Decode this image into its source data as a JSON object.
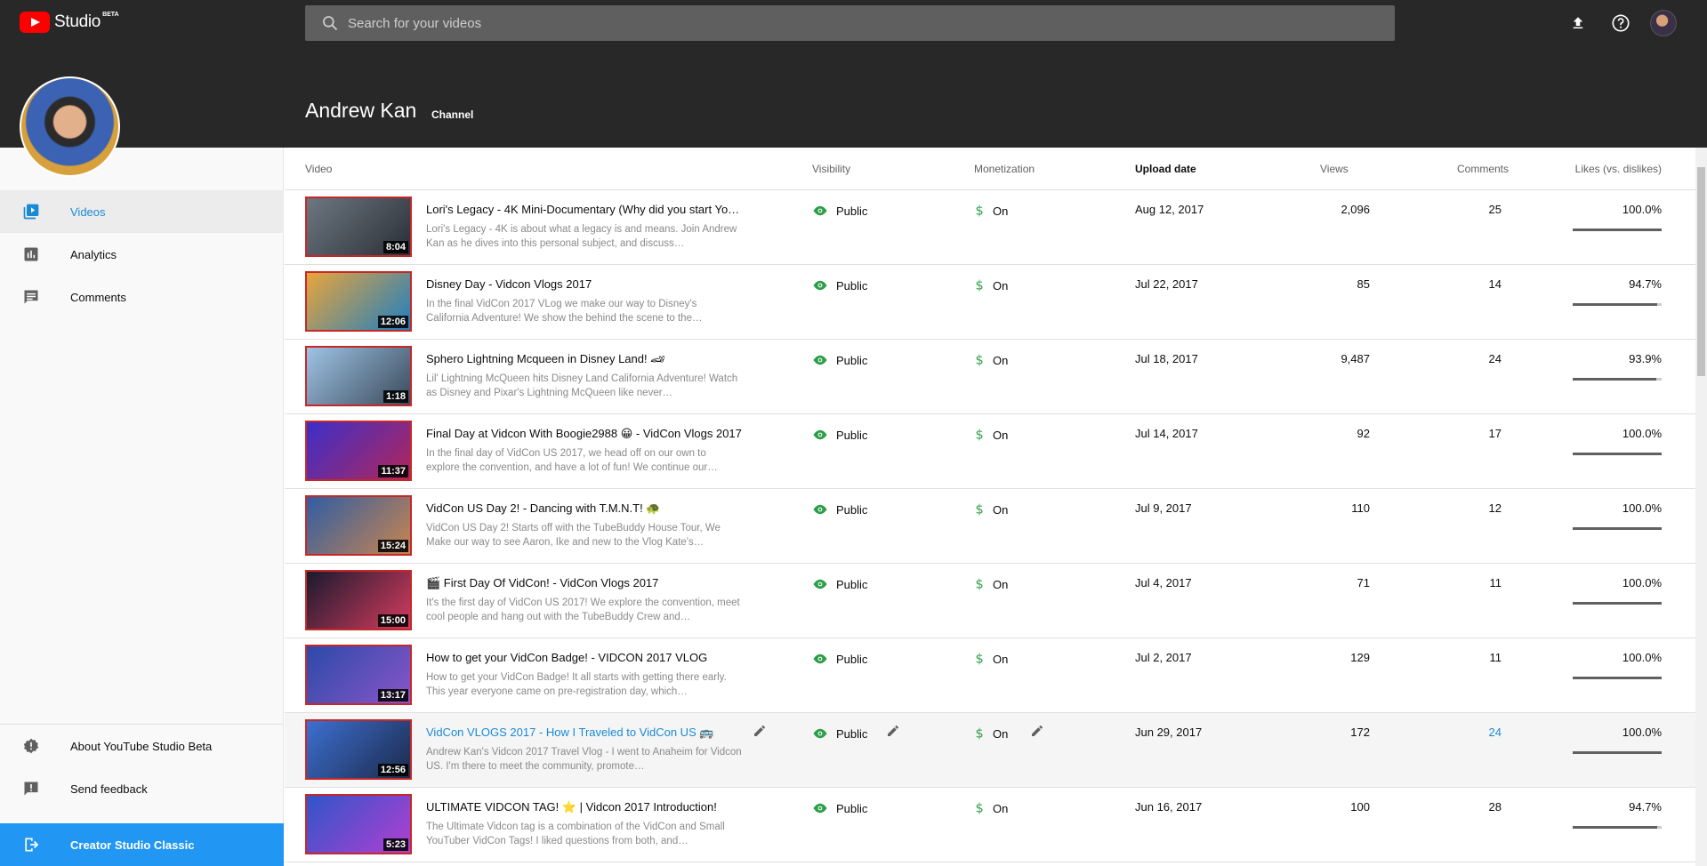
{
  "app": {
    "logo_text": "Studio",
    "beta": "BETA"
  },
  "search": {
    "placeholder": "Search for your videos"
  },
  "channel": {
    "name": "Andrew Kan",
    "label": "Channel"
  },
  "sidebar": {
    "items": [
      {
        "label": "Videos",
        "icon": "video-library-icon",
        "active": true
      },
      {
        "label": "Analytics",
        "icon": "analytics-icon",
        "active": false
      },
      {
        "label": "Comments",
        "icon": "comments-icon",
        "active": false
      }
    ],
    "bottom_items": [
      {
        "label": "About YouTube Studio Beta",
        "icon": "info-icon"
      },
      {
        "label": "Send feedback",
        "icon": "feedback-icon"
      }
    ],
    "classic_label": "Creator Studio Classic"
  },
  "table": {
    "headers": {
      "video": "Video",
      "visibility": "Visibility",
      "monetization": "Monetization",
      "upload_date": "Upload date",
      "views": "Views",
      "comments": "Comments",
      "likes": "Likes (vs. dislikes)"
    },
    "rows": [
      {
        "title": "Lori's Legacy - 4K Mini-Documentary (Why did you start Yo…",
        "description": "Lori's Legacy - 4K is about what a legacy is and means. Join Andrew Kan as he dives into this personal subject, and discuss…",
        "duration": "8:04",
        "visibility": "Public",
        "monetization": "On",
        "date": "Aug 12, 2017",
        "views": "2,096",
        "comments": "25",
        "likes": "100.0%",
        "likes_fraction": 1.0,
        "thumb_colors": [
          "#6d7781",
          "#2a2f36"
        ]
      },
      {
        "title": "Disney Day - Vidcon Vlogs 2017",
        "description": "In the final VidCon 2017 VLog we make our way to Disney's California Adventure! We show the behind the scene to the…",
        "duration": "12:06",
        "visibility": "Public",
        "monetization": "On",
        "date": "Jul 22, 2017",
        "views": "85",
        "comments": "14",
        "likes": "94.7%",
        "likes_fraction": 0.947,
        "thumb_colors": [
          "#e9a53a",
          "#1e7fc1"
        ]
      },
      {
        "title": "Sphero Lightning Mcqueen in Disney Land! 🏎",
        "description": "Lil' Lightning McQueen hits Disney Land California Adventure! Watch as Disney and Pixar's Lightning McQueen like never…",
        "duration": "1:18",
        "visibility": "Public",
        "monetization": "On",
        "date": "Jul 18, 2017",
        "views": "9,487",
        "comments": "24",
        "likes": "93.9%",
        "likes_fraction": 0.939,
        "thumb_colors": [
          "#9ec3e6",
          "#3b4a5a"
        ]
      },
      {
        "title": "Final Day at Vidcon With Boogie2988 😀 - VidCon Vlogs 2017",
        "description": "In the final day of VidCon US 2017, we head off on our own to explore the convention, and have a lot of fun! We continue our…",
        "duration": "11:37",
        "visibility": "Public",
        "monetization": "On",
        "date": "Jul 14, 2017",
        "views": "92",
        "comments": "17",
        "likes": "100.0%",
        "likes_fraction": 1.0,
        "thumb_colors": [
          "#3b2fc8",
          "#b2265b"
        ]
      },
      {
        "title": "VidCon US Day 2! - Dancing with T.M.N.T! 🐢",
        "description": "VidCon US Day 2! Starts off with the TubeBuddy House Tour, We Make our way to see Aaron, Ike and new to the Vlog Kate's…",
        "duration": "15:24",
        "visibility": "Public",
        "monetization": "On",
        "date": "Jul 9, 2017",
        "views": "110",
        "comments": "12",
        "likes": "100.0%",
        "likes_fraction": 1.0,
        "thumb_colors": [
          "#2f5da3",
          "#c9844f"
        ]
      },
      {
        "title": "🎬 First Day Of VidCon! - VidCon Vlogs 2017",
        "description": "It's the first day of VidCon US 2017! We explore the convention, meet cool people and hang out with the TubeBuddy Crew and…",
        "duration": "15:00",
        "visibility": "Public",
        "monetization": "On",
        "date": "Jul 4, 2017",
        "views": "71",
        "comments": "11",
        "likes": "100.0%",
        "likes_fraction": 1.0,
        "thumb_colors": [
          "#1a1a2e",
          "#d43b5e"
        ]
      },
      {
        "title": "How to get your VidCon Badge! - VIDCON 2017 VLOG",
        "description": "How to get your VidCon Badge! It all starts with getting there early. This year everyone came on pre-registration day, which…",
        "duration": "13:17",
        "visibility": "Public",
        "monetization": "On",
        "date": "Jul 2, 2017",
        "views": "129",
        "comments": "11",
        "likes": "100.0%",
        "likes_fraction": 1.0,
        "thumb_colors": [
          "#2b4aa8",
          "#8a55c8"
        ]
      },
      {
        "title": "VidCon VLOGS 2017 - How I Traveled to VidCon US 🚌",
        "description": "Andrew Kan's Vidcon 2017 Travel Vlog - I went to Anaheim for Vidcon US. I'm there to meet the community, promote…",
        "duration": "12:56",
        "visibility": "Public",
        "monetization": "On",
        "date": "Jun 29, 2017",
        "views": "172",
        "comments": "24",
        "likes": "100.0%",
        "likes_fraction": 1.0,
        "thumb_colors": [
          "#3d6fd1",
          "#1c2a4a"
        ]
      },
      {
        "title": "ULTIMATE VIDCON TAG! ⭐ | Vidcon 2017 Introduction!",
        "description": "The Ultimate Vidcon tag is a combination of the VidCon and Small YouTuber VidCon Tags! I liked questions from both, and…",
        "duration": "5:23",
        "visibility": "Public",
        "monetization": "On",
        "date": "Jun 16, 2017",
        "views": "100",
        "comments": "28",
        "likes": "94.7%",
        "likes_fraction": 0.947,
        "thumb_colors": [
          "#2f55c9",
          "#b23fd1"
        ]
      }
    ]
  },
  "colors": {
    "accent": "#1a8ad6",
    "header_bg": "#282828",
    "classic_bg": "#2196f3",
    "public_icon": "#2e9e48",
    "money_icon": "#2e9e48"
  }
}
